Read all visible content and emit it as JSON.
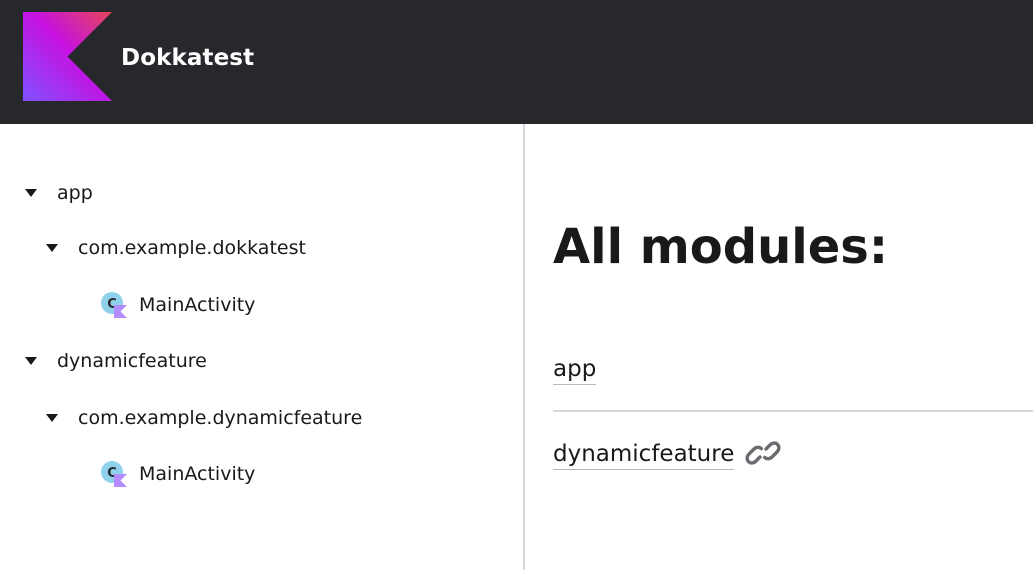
{
  "header": {
    "brand_name": "Dokkatest",
    "logo": "kotlin-logo",
    "colors": {
      "background": "#27282c",
      "logo_gradient": [
        "#e44857",
        "#c711e1",
        "#7f52ff"
      ]
    }
  },
  "sidebar": {
    "items": [
      {
        "label": "app",
        "level": 0,
        "expanded": true,
        "icon": "caret-down-icon"
      },
      {
        "label": "com.example.dokkatest",
        "level": 1,
        "expanded": true,
        "icon": "caret-down-icon"
      },
      {
        "label": "MainActivity",
        "level": 2,
        "icon": "kotlin-class-icon"
      },
      {
        "label": "dynamicfeature",
        "level": 0,
        "expanded": true,
        "icon": "caret-down-icon"
      },
      {
        "label": "com.example.dynamicfeature",
        "level": 1,
        "expanded": true,
        "icon": "caret-down-icon"
      },
      {
        "label": "MainActivity",
        "level": 2,
        "icon": "kotlin-class-icon"
      }
    ]
  },
  "main": {
    "title": "All modules:",
    "modules": [
      {
        "name": "app"
      },
      {
        "name": "dynamicfeature",
        "icon": "link-icon"
      }
    ]
  }
}
